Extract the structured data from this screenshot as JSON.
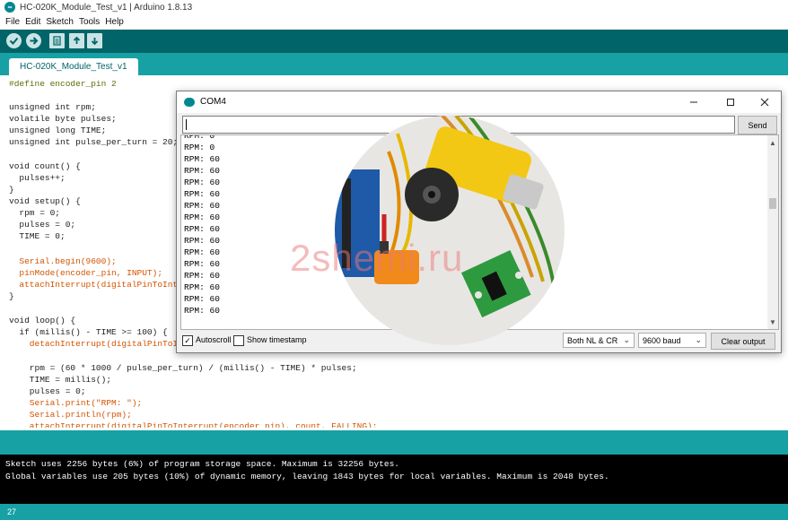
{
  "window": {
    "title": "HC-020K_Module_Test_v1 | Arduino 1.8.13"
  },
  "menu": [
    "File",
    "Edit",
    "Sketch",
    "Tools",
    "Help"
  ],
  "toolbar": {
    "buttons": [
      "verify-icon",
      "upload-icon",
      "new-icon",
      "open-icon",
      "save-icon"
    ]
  },
  "tab": {
    "label": "HC-020K_Module_Test_v1"
  },
  "code": [
    "#define encoder_pin 2",
    "",
    "unsigned int rpm;",
    "volatile byte pulses;",
    "unsigned long TIME;",
    "unsigned int pulse_per_turn = 20;",
    "",
    "void count() {",
    "  pulses++;",
    "}",
    "void setup() {",
    "  rpm = 0;",
    "  pulses = 0;",
    "  TIME = 0;",
    "",
    "  Serial.begin(9600);",
    "  pinMode(encoder_pin, INPUT);",
    "  attachInterrupt(digitalPinToInte",
    "}",
    "",
    "void loop() {",
    "  if (millis() - TIME >= 100) {",
    "    detachInterrupt(digitalPinToIn",
    "",
    "    rpm = (60 * 1000 / pulse_per_turn) / (millis() - TIME) * pulses;",
    "    TIME = millis();",
    "    pulses = 0;",
    "    Serial.print(\"RPM: \");",
    "    Serial.println(rpm);",
    "    attachInterrupt(digitalPinToInterrupt(encoder_pin), count, FALLING);"
  ],
  "console": {
    "lines": [
      "Sketch uses 2256 bytes (6%) of program storage space. Maximum is 32256 bytes.",
      "Global variables use 205 bytes (10%) of dynamic memory, leaving 1843 bytes for local variables. Maximum is 2048 bytes."
    ]
  },
  "status": {
    "line_number": "27"
  },
  "serial_monitor": {
    "title": "COM4",
    "input_value": "",
    "send_label": "Send",
    "output_lines": [
      "RPM: 0",
      "RPM: 0",
      "RPM: 60",
      "RPM: 60",
      "RPM: 60",
      "RPM: 60",
      "RPM: 60",
      "RPM: 60",
      "RPM: 60",
      "RPM: 60",
      "RPM: 60",
      "RPM: 60",
      "RPM: 60",
      "RPM: 60",
      "RPM: 60",
      "RPM: 60"
    ],
    "autoscroll_label": "Autoscroll",
    "autoscroll_checked": true,
    "timestamp_label": "Show timestamp",
    "timestamp_checked": false,
    "line_ending": "Both NL & CR",
    "baud": "9600 baud",
    "clear_label": "Clear output"
  },
  "watermark": "2shemi.ru",
  "colors": {
    "arduino_dark": "#006468",
    "arduino_teal": "#17a1a5"
  }
}
